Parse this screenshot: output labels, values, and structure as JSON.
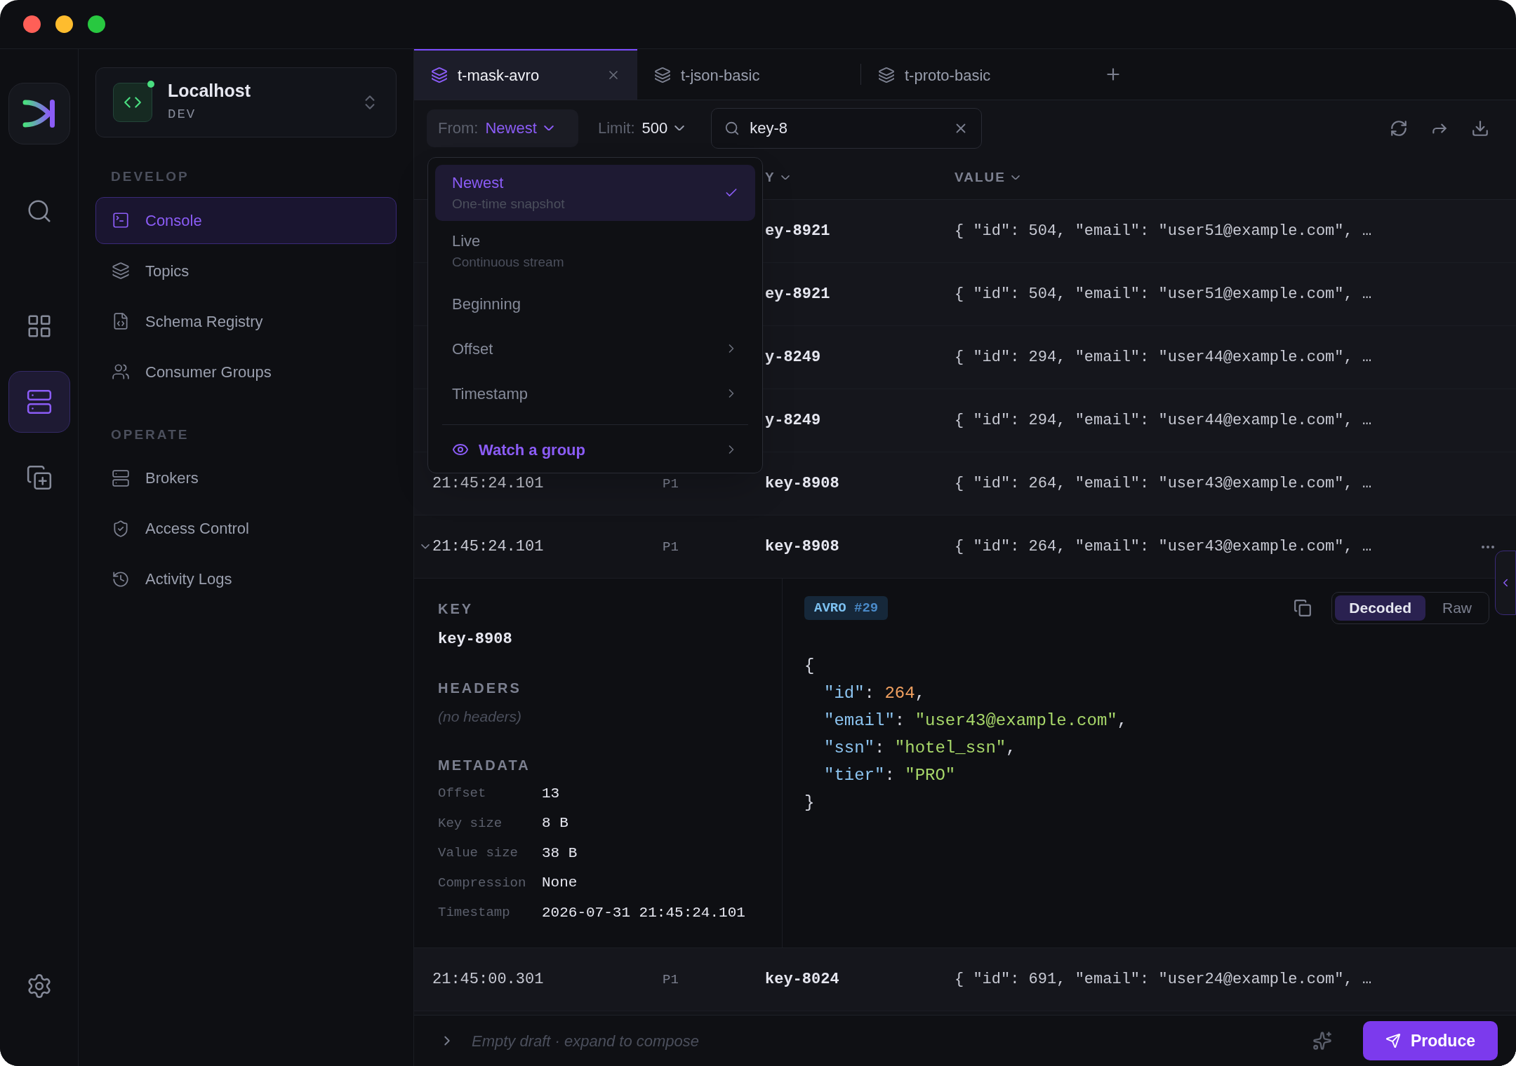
{
  "rail": {
    "items": [
      {
        "kind": "search",
        "selected": false
      },
      {
        "kind": "grid",
        "selected": false
      },
      {
        "kind": "servers",
        "selected": true
      },
      {
        "kind": "copy",
        "selected": false
      }
    ]
  },
  "connection": {
    "name": "Localhost",
    "env": "DEV",
    "online": true
  },
  "sidebar": {
    "sections": [
      {
        "title": "DEVELOP",
        "items": [
          {
            "label": "Console",
            "kind": "console",
            "selected": true
          },
          {
            "label": "Topics",
            "kind": "layers",
            "selected": false
          },
          {
            "label": "Schema Registry",
            "kind": "file",
            "selected": false
          },
          {
            "label": "Consumer Groups",
            "kind": "users",
            "selected": false
          }
        ]
      },
      {
        "title": "OPERATE",
        "items": [
          {
            "label": "Brokers",
            "kind": "servers",
            "selected": false
          },
          {
            "label": "Access Control",
            "kind": "shield",
            "selected": false
          },
          {
            "label": "Activity Logs",
            "kind": "history",
            "selected": false
          }
        ]
      }
    ]
  },
  "tabs": [
    {
      "label": "t-mask-avro",
      "selected": true
    },
    {
      "label": "t-json-basic",
      "selected": false
    },
    {
      "label": "t-proto-basic",
      "selected": false
    }
  ],
  "toolbar": {
    "from_label": "From:",
    "from_value": "Newest",
    "limit_label": "Limit:",
    "limit_value": "500",
    "search": {
      "value": "key-8"
    }
  },
  "dropdown": {
    "items": [
      {
        "kind": "option",
        "label": "Newest",
        "sublabel": "One-time snapshot",
        "selected": true
      },
      {
        "kind": "option",
        "label": "Live",
        "sublabel": "Continuous stream",
        "selected": false
      },
      {
        "kind": "option",
        "label": "Beginning",
        "selected": false
      },
      {
        "kind": "submenu",
        "label": "Offset",
        "selected": false
      },
      {
        "kind": "submenu",
        "label": "Timestamp",
        "selected": false
      },
      {
        "kind": "action",
        "label": "Watch a group",
        "selected": false
      }
    ]
  },
  "table": {
    "columns": [
      "Y",
      "VALUE"
    ],
    "rows": [
      {
        "key": "ey-8921",
        "value": "{ \"id\": 504, \"email\": \"user51@example.com\", …",
        "expanded": false
      },
      {
        "key": "ey-8921",
        "value": "{ \"id\": 504, \"email\": \"user51@example.com\", …",
        "expanded": false
      },
      {
        "key": "y-8249",
        "value": "{ \"id\": 294, \"email\": \"user44@example.com\", …",
        "expanded": false
      },
      {
        "key": "y-8249",
        "value": "{ \"id\": 294, \"email\": \"user44@example.com\", …",
        "expanded": false
      },
      {
        "timestamp": "21:45:24.101",
        "partition": "P1",
        "key": "key-8908",
        "value": "{ \"id\": 264, \"email\": \"user43@example.com\", …",
        "expanded": false
      },
      {
        "timestamp": "21:45:24.101",
        "partition": "P1",
        "key": "key-8908",
        "value": "{ \"id\": 264, \"email\": \"user43@example.com\", …",
        "expanded": true
      },
      {
        "timestamp": "21:45:00.301",
        "partition": "P1",
        "key": "key-8024",
        "value": "{ \"id\": 691, \"email\": \"user24@example.com\", …",
        "expanded": false
      }
    ]
  },
  "detail": {
    "key_label": "KEY",
    "key": "key-8908",
    "headers_label": "HEADERS",
    "headers_empty": "(no headers)",
    "metadata_label": "METADATA",
    "metadata": [
      {
        "label": "Offset",
        "value": "13"
      },
      {
        "label": "Key size",
        "value": "8 B"
      },
      {
        "label": "Value size",
        "value": "38 B"
      },
      {
        "label": "Compression",
        "value": "None"
      },
      {
        "label": "Timestamp",
        "value": "2026-07-31 21:45:24.101"
      }
    ],
    "format": "AVRO",
    "schema_version": "#29",
    "view_modes": [
      {
        "label": "Decoded",
        "selected": true
      },
      {
        "label": "Raw",
        "selected": false
      }
    ],
    "json_lines": [
      [
        {
          "kind": "punct",
          "text": "{"
        }
      ],
      [
        {
          "kind": "key",
          "text": "\"id\""
        },
        {
          "kind": "punct",
          "text": ": "
        },
        {
          "kind": "number",
          "text": "264"
        },
        {
          "kind": "punct",
          "text": ","
        }
      ],
      [
        {
          "kind": "key",
          "text": "\"email\""
        },
        {
          "kind": "punct",
          "text": ": "
        },
        {
          "kind": "string",
          "text": "\"user43@example.com\""
        },
        {
          "kind": "punct",
          "text": ","
        }
      ],
      [
        {
          "kind": "key",
          "text": "\"ssn\""
        },
        {
          "kind": "punct",
          "text": ": "
        },
        {
          "kind": "string",
          "text": "\"hotel_ssn\""
        },
        {
          "kind": "punct",
          "text": ","
        }
      ],
      [
        {
          "kind": "key",
          "text": "\"tier\""
        },
        {
          "kind": "punct",
          "text": ": "
        },
        {
          "kind": "string",
          "text": "\"PRO\""
        }
      ],
      [
        {
          "kind": "punct",
          "text": "}"
        }
      ]
    ]
  },
  "composer": {
    "placeholder": "Empty draft · expand to compose",
    "button": "Produce"
  }
}
